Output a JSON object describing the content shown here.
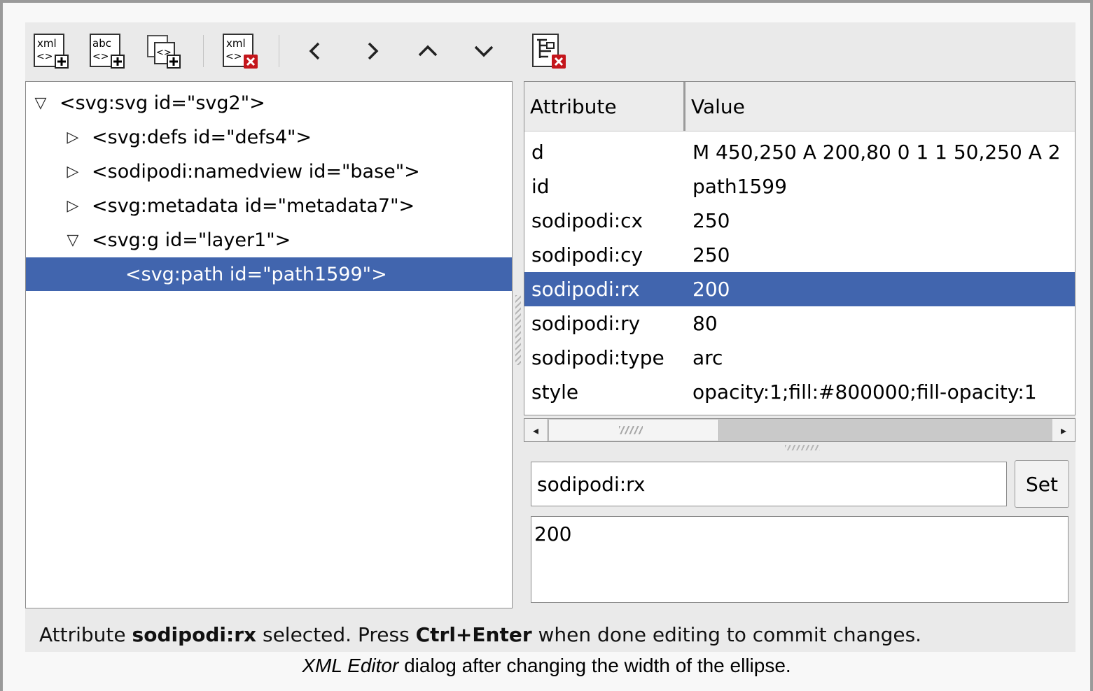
{
  "toolbar": {
    "new_element_node": {
      "icon": "xml-new-element-icon",
      "text": "xml"
    },
    "new_text_node": {
      "icon": "xml-new-text-icon",
      "text": "abc"
    },
    "duplicate_node": {
      "icon": "duplicate-node-icon"
    },
    "delete_node": {
      "icon": "xml-delete-node-icon",
      "text": "xml"
    },
    "unindent": {
      "icon": "chevron-left-icon"
    },
    "indent": {
      "icon": "chevron-right-icon"
    },
    "raise": {
      "icon": "chevron-up-icon"
    },
    "lower": {
      "icon": "chevron-down-icon"
    },
    "delete_attribute": {
      "icon": "delete-attribute-icon"
    }
  },
  "tree": {
    "nodes": [
      {
        "label": "<svg:svg id=\"svg2\">",
        "expander": "▽",
        "depth": 0,
        "selected": false
      },
      {
        "label": "<svg:defs id=\"defs4\">",
        "expander": "▷",
        "depth": 1,
        "selected": false
      },
      {
        "label": "<sodipodi:namedview id=\"base\">",
        "expander": "▷",
        "depth": 1,
        "selected": false
      },
      {
        "label": "<svg:metadata id=\"metadata7\">",
        "expander": "▷",
        "depth": 1,
        "selected": false
      },
      {
        "label": "<svg:g id=\"layer1\">",
        "expander": "▽",
        "depth": 1,
        "selected": false
      },
      {
        "label": "<svg:path id=\"path1599\">",
        "expander": "",
        "depth": 2,
        "selected": true
      }
    ]
  },
  "attributes": {
    "header": {
      "attribute": "Attribute",
      "value": "Value"
    },
    "rows": [
      {
        "name": "d",
        "value": "M 450,250 A 200,80 0 1 1 50,250 A 2",
        "selected": false
      },
      {
        "name": "id",
        "value": "path1599",
        "selected": false
      },
      {
        "name": "sodipodi:cx",
        "value": "250",
        "selected": false
      },
      {
        "name": "sodipodi:cy",
        "value": "250",
        "selected": false
      },
      {
        "name": "sodipodi:rx",
        "value": "200",
        "selected": true
      },
      {
        "name": "sodipodi:ry",
        "value": "80",
        "selected": false
      },
      {
        "name": "sodipodi:type",
        "value": "arc",
        "selected": false
      },
      {
        "name": "style",
        "value": "opacity:1;fill:#800000;fill-opacity:1",
        "selected": false
      }
    ],
    "scroll_position": 0
  },
  "editor": {
    "attribute_name": "sodipodi:rx",
    "set_label": "Set",
    "attribute_value": "200"
  },
  "status": {
    "part1": "Attribute ",
    "attr": "sodipodi:rx",
    "part2": " selected. Press ",
    "key": "Ctrl+Enter",
    "part3": " when done editing to commit changes."
  },
  "caption": {
    "italic": "XML Editor",
    "rest": " dialog after changing the width of the ellipse."
  },
  "colors": {
    "selection": "#4165ae",
    "delete_badge": "#c4161c"
  }
}
